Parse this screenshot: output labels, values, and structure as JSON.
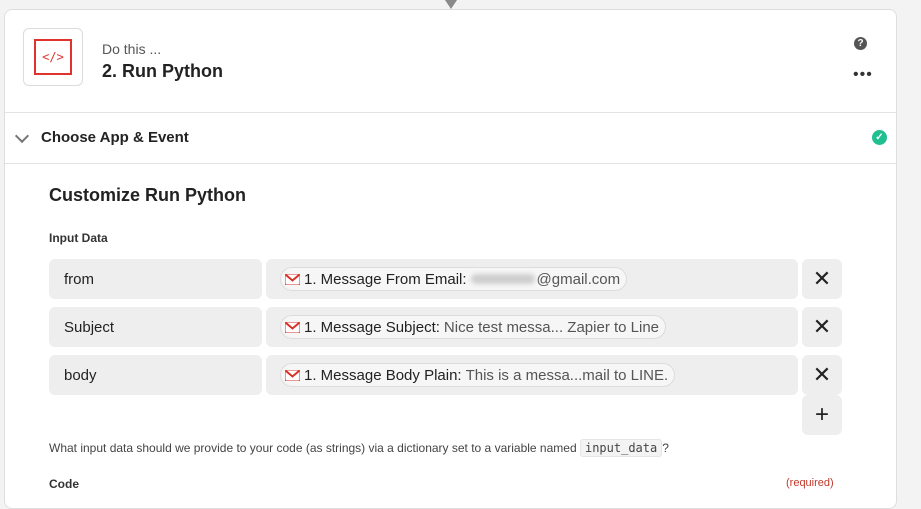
{
  "step": {
    "kicker": "Do this ...",
    "title": "2. Run Python",
    "app_icon_glyph": "</>",
    "accent_color": "#e0332d",
    "help_glyph": "?",
    "more_glyph": "•••"
  },
  "section": {
    "label": "Choose App & Event",
    "status_icon": "check-circle-icon",
    "status_color": "#1fbf8f",
    "check_glyph": "✓"
  },
  "customize": {
    "title": "Customize Run Python",
    "input_data_label": "Input Data",
    "rows": [
      {
        "key": "from",
        "source": "1. Message From Email:",
        "value": "@gmail.com",
        "redacted": true
      },
      {
        "key": "Subject",
        "source": "1. Message Subject:",
        "value": "Nice test messa... Zapier to Line",
        "redacted": false
      },
      {
        "key": "body",
        "source": "1. Message Body Plain:",
        "value": "This is a messa...mail to LINE.",
        "redacted": false
      }
    ],
    "remove_glyph": "✕",
    "add_glyph": "+",
    "help_text_before": "What input data should we provide to your code (as strings) via a dictionary set to a variable named",
    "help_code": "input_data",
    "help_text_after": "?",
    "code_label": "Code",
    "required_label": "(required)"
  }
}
